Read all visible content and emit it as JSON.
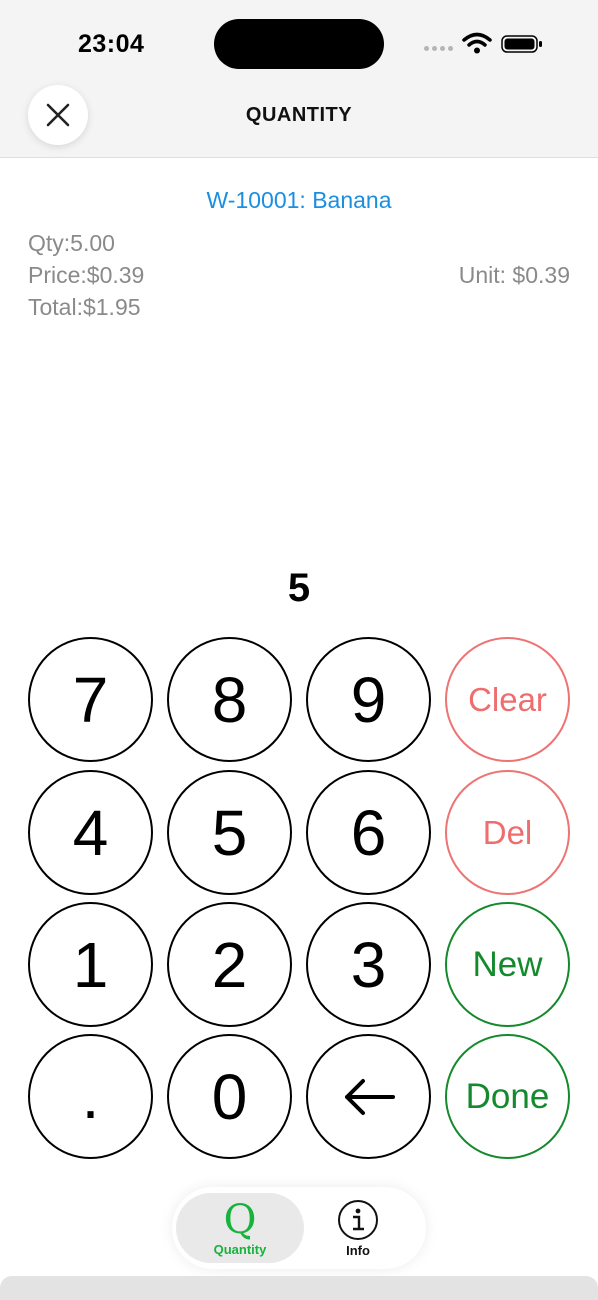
{
  "status_bar": {
    "time": "23:04"
  },
  "header": {
    "title": "QUANTITY"
  },
  "item": {
    "title": "W-10001: Banana",
    "qty": "Qty:5.00",
    "price": "Price:$0.39",
    "total": "Total:$1.95",
    "unit": "Unit: $0.39"
  },
  "display": {
    "value": "5"
  },
  "keypad": {
    "k7": "7",
    "k8": "8",
    "k9": "9",
    "k4": "4",
    "k5": "5",
    "k6": "6",
    "k1": "1",
    "k2": "2",
    "k3": "3",
    "dot": ".",
    "k0": "0",
    "clear": "Clear",
    "del": "Del",
    "new": "New",
    "done": "Done"
  },
  "tabbar": {
    "quantity_glyph": "Q",
    "quantity_label": "Quantity",
    "info_label": "Info"
  },
  "colors": {
    "accent_blue": "#1a8fe0",
    "clear_red": "#ee6e6e",
    "done_green": "#148a2c",
    "tab_active_green": "#17b33d"
  }
}
